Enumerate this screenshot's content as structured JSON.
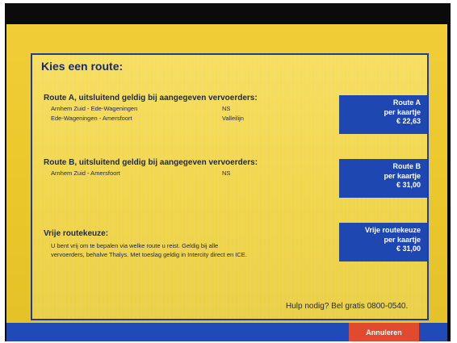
{
  "screen": {
    "title": "Kies een route:",
    "route_a": {
      "heading": "Route A, uitsluitend geldig bij aangegeven vervoerders:",
      "legs": [
        {
          "route": "Arnhem Zuid - Ede-Wageningen",
          "operator": "NS"
        },
        {
          "route": "Ede-Wageningen - Amersfoort",
          "operator": "Valleilijn"
        }
      ],
      "button": {
        "line1": "Route A",
        "line2": "per kaartje",
        "price": "€ 22,63"
      }
    },
    "route_b": {
      "heading": "Route B, uitsluitend geldig bij aangegeven vervoerders:",
      "legs": [
        {
          "route": "Arnhem Zuid - Amersfoort",
          "operator": "NS"
        }
      ],
      "button": {
        "line1": "Route B",
        "line2": "per kaartje",
        "price": "€ 31,00"
      }
    },
    "free_choice": {
      "heading": "Vrije routekeuze:",
      "description_line1": "U bent vrij om te bepalen via welke route u reist. Geldig bij alle",
      "description_line2": "vervoerders, behalve Thalys. Met toeslag geldig in Intercity direct en ICE.",
      "button": {
        "line1": "Vrije routekeuze",
        "line2": "per kaartje",
        "price": "€ 31,00"
      }
    },
    "help_text": "Hulp nodig? Bel gratis 0800-0540.",
    "cancel_label": "Annuleren"
  },
  "colors": {
    "screen_yellow": "#f0d54c",
    "button_blue": "#1f47b2",
    "cancel_red": "#e04a2e",
    "text_navy": "#1c2552"
  }
}
